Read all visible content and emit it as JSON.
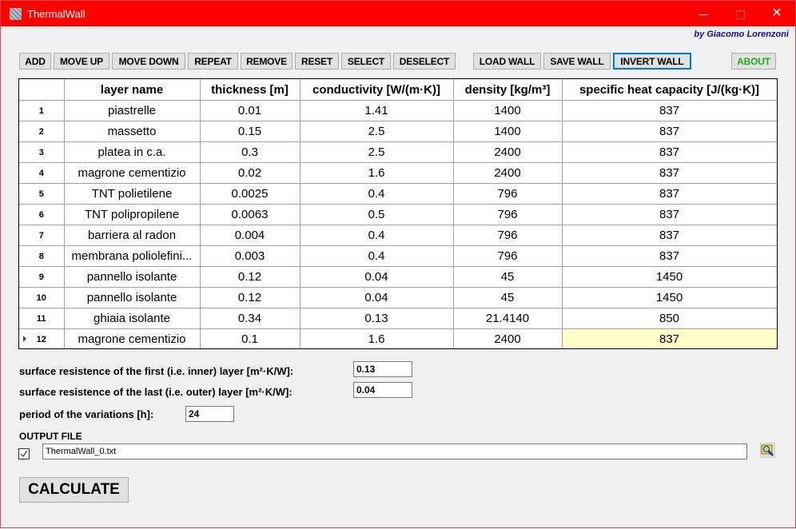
{
  "window": {
    "title": "ThermalWall",
    "author": "by Giacomo Lorenzoni",
    "controls": {
      "minimize": "—",
      "maximize": "",
      "close": "✕"
    }
  },
  "toolbar": {
    "add": "ADD",
    "move_up": "MOVE UP",
    "move_down": "MOVE DOWN",
    "repeat": "REPEAT",
    "remove": "REMOVE",
    "reset": "RESET",
    "select": "SELECT",
    "deselect": "DESELECT",
    "load_wall": "LOAD WALL",
    "save_wall": "SAVE WALL",
    "invert_wall": "INVERT WALL",
    "about": "ABOUT"
  },
  "colors": {
    "titlebar": "#ff0000",
    "author": "#0d0d9a",
    "about": "#1eae1e",
    "focus": "#0078d7",
    "current_cell": "#ffffc8"
  },
  "grid": {
    "columns": [
      "",
      "layer name",
      "thickness  [m]",
      "conductivity  [W/(m·K)]",
      "density  [kg/m³]",
      "specific heat capacity  [J/(kg·K)]"
    ],
    "rows": [
      {
        "n": "1",
        "name": "piastrelle",
        "thickness": "0.01",
        "conductivity": "1.41",
        "density": "1400",
        "cp": "837"
      },
      {
        "n": "2",
        "name": "massetto",
        "thickness": "0.15",
        "conductivity": "2.5",
        "density": "1400",
        "cp": "837"
      },
      {
        "n": "3",
        "name": "platea in c.a.",
        "thickness": "0.3",
        "conductivity": "2.5",
        "density": "2400",
        "cp": "837"
      },
      {
        "n": "4",
        "name": "magrone cementizio",
        "thickness": "0.02",
        "conductivity": "1.6",
        "density": "2400",
        "cp": "837"
      },
      {
        "n": "5",
        "name": "TNT polietilene",
        "thickness": "0.0025",
        "conductivity": "0.4",
        "density": "796",
        "cp": "837"
      },
      {
        "n": "6",
        "name": "TNT polipropilene",
        "thickness": "0.0063",
        "conductivity": "0.5",
        "density": "796",
        "cp": "837"
      },
      {
        "n": "7",
        "name": "barriera al radon",
        "thickness": "0.004",
        "conductivity": "0.4",
        "density": "796",
        "cp": "837"
      },
      {
        "n": "8",
        "name": "membrana poliolefini...",
        "thickness": "0.003",
        "conductivity": "0.4",
        "density": "796",
        "cp": "837"
      },
      {
        "n": "9",
        "name": "pannello isolante",
        "thickness": "0.12",
        "conductivity": "0.04",
        "density": "45",
        "cp": "1450"
      },
      {
        "n": "10",
        "name": "pannello isolante",
        "thickness": "0.12",
        "conductivity": "0.04",
        "density": "45",
        "cp": "1450"
      },
      {
        "n": "11",
        "name": "ghiaia isolante",
        "thickness": "0.34",
        "conductivity": "0.13",
        "density": "21.4140",
        "cp": "850"
      },
      {
        "n": "12",
        "name": "magrone cementizio",
        "thickness": "0.1",
        "conductivity": "1.6",
        "density": "2400",
        "cp": "837",
        "current": true
      }
    ]
  },
  "params": {
    "inner_label": "surface resistence of the first (i.e. inner) layer [m²·K/W]:",
    "inner_value": "0.13",
    "outer_label": "surface resistence of the last (i.e. outer) layer [m²·K/W]:",
    "outer_value": "0.04",
    "period_label": "period of the variations [h]:",
    "period_value": "24"
  },
  "output": {
    "label": "OUTPUT FILE",
    "checked": true,
    "filename": "ThermalWall_0.txt",
    "browse_icon": "folder-search-icon"
  },
  "calculate": "CALCULATE"
}
